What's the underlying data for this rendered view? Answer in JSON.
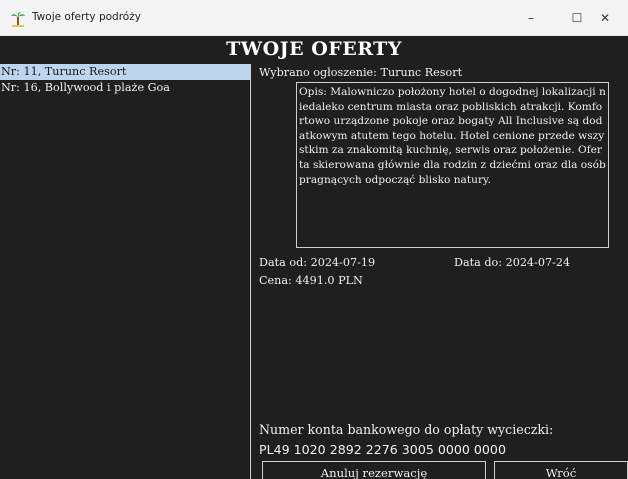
{
  "window": {
    "title": "Twoje oferty podróży",
    "icon": "palm-tree-icon",
    "controls": {
      "minimize": "–",
      "maximize": "☐",
      "close": "✕"
    }
  },
  "app": {
    "heading": "TWOJE OFERTY",
    "offers": [
      {
        "label": "Nr: 11, Turunc Resort",
        "selected": true
      },
      {
        "label": "Nr: 16, Bollywood i plaże Goa",
        "selected": false
      }
    ],
    "selected_label": "Wybrano ogłoszenie: Turunc Resort",
    "description": "Opis: Malowniczo położony hotel o dogodnej lokalizacji niedaleko centrum miasta oraz pobliskich atrakcji. Komfortowo urządzone pokoje oraz bogaty All Inclusive są dodatkowym atutem tego hotelu. Hotel cenione przede wszystkim za znakomitą kuchnię, serwis oraz położenie. Oferta skierowana głównie dla rodzin z dziećmi oraz dla osób pragnących odpocząć blisko natury.",
    "date_from": "Data od: 2024-07-19",
    "date_to": "Data do: 2024-07-24",
    "price": "Cena: 4491.0 PLN",
    "account_label": "Numer konta bankowego do opłaty wycieczki:",
    "account_number": "PL49 1020 2892 2276 3005 0000 0000",
    "cancel_button": "Anuluj rezerwację",
    "back_button": "Wróć"
  },
  "colors": {
    "background": "#1f1f1f",
    "selection": "#bcd6ef",
    "text": "#f0f0f0"
  }
}
